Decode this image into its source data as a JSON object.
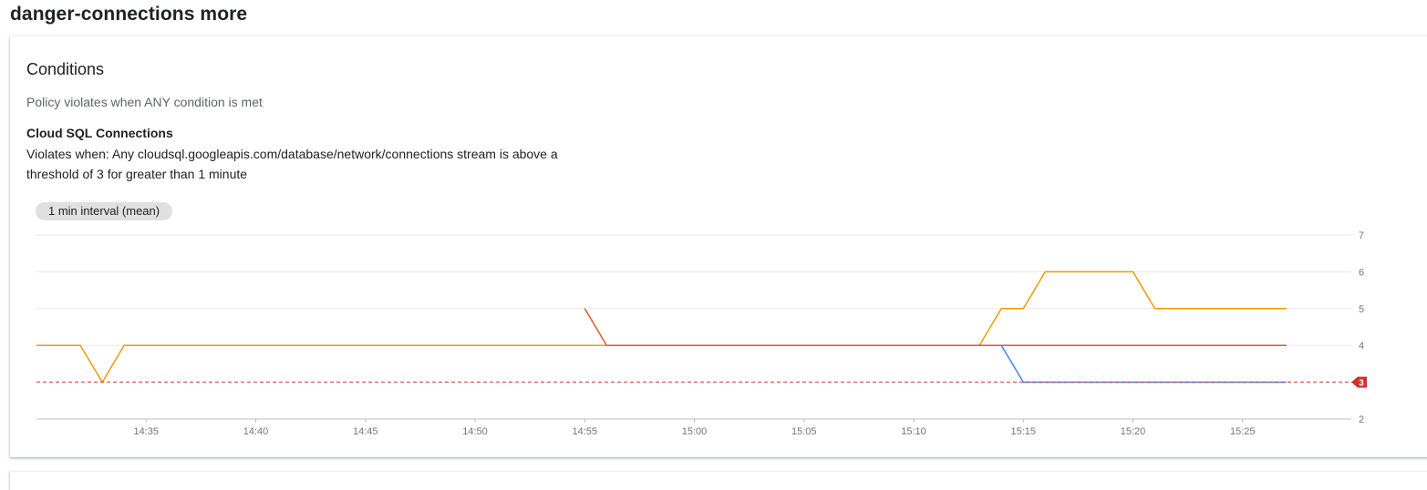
{
  "page": {
    "title": "danger-connections more"
  },
  "conditions": {
    "heading": "Conditions",
    "policy": "Policy violates when ANY condition is met",
    "condition_name": "Cloud SQL Connections",
    "condition_desc": "Violates when: Any cloudsql.googleapis.com/database/network/connections stream is above a threshold of 3 for greater than 1 minute"
  },
  "chart": {
    "interval_chip": "1 min interval (mean)",
    "threshold_label": "3"
  },
  "colors": {
    "orange": "#f29900",
    "red": "#e8522c",
    "blue": "#4285f4",
    "threshold": "#d32f2f"
  },
  "chart_data": {
    "type": "line",
    "title": "",
    "xlabel": "",
    "ylabel": "",
    "ylim": [
      2,
      7
    ],
    "yticks": [
      "7",
      "6",
      "5",
      "4",
      "2"
    ],
    "xticks": [
      "14:35",
      "14:40",
      "14:45",
      "14:50",
      "14:55",
      "15:00",
      "15:05",
      "15:10",
      "15:15",
      "15:20",
      "15:25"
    ],
    "x_range": [
      "14:30",
      "15:29"
    ],
    "threshold": 3,
    "grid": true,
    "series": [
      {
        "color": "#f29900",
        "points": [
          [
            "14:30",
            4
          ],
          [
            "14:32",
            4
          ],
          [
            "14:33",
            3
          ],
          [
            "14:34",
            4
          ],
          [
            "14:55",
            4
          ],
          [
            "15:13",
            4
          ],
          [
            "15:14",
            5
          ],
          [
            "15:15",
            5
          ],
          [
            "15:16",
            6
          ],
          [
            "15:20",
            6
          ],
          [
            "15:21",
            5
          ],
          [
            "15:27",
            5
          ]
        ]
      },
      {
        "color": "#e8522c",
        "points": [
          [
            "14:55",
            5
          ],
          [
            "14:56",
            4
          ],
          [
            "15:27",
            4
          ]
        ]
      },
      {
        "color": "#4285f4",
        "points": [
          [
            "15:14",
            4
          ],
          [
            "15:15",
            3
          ],
          [
            "15:27",
            3
          ]
        ]
      }
    ]
  }
}
